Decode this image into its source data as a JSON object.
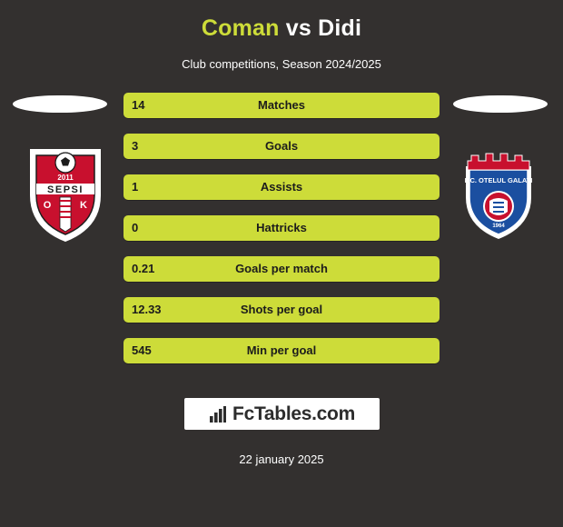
{
  "header": {
    "player_left": "Coman",
    "vs": "vs",
    "player_right": "Didi",
    "subtitle": "Club competitions, Season 2024/2025"
  },
  "colors": {
    "background": "#33302f",
    "bar": "#cddc39",
    "accent_title": "#cddc39",
    "text_light": "#ffffff",
    "text_dark": "#1c1c1c"
  },
  "teams": {
    "left": {
      "name": "Sepsi OSK",
      "crest_text_year": "2011",
      "crest_text_main": "SEPSI",
      "crest_letters": "OSK"
    },
    "right": {
      "name": "FC Otelul Galati",
      "crest_text_main": "F.C. OTELUL GALATI",
      "crest_text_small": "1964"
    }
  },
  "chart_data": {
    "type": "table",
    "title": "Coman vs Didi",
    "subtitle": "Club competitions, Season 2024/2025",
    "categories": [
      "Matches",
      "Goals",
      "Assists",
      "Hattricks",
      "Goals per match",
      "Shots per goal",
      "Min per goal"
    ],
    "series": [
      {
        "name": "Coman",
        "values": [
          "14",
          "3",
          "1",
          "0",
          "0.21",
          "12.33",
          "545"
        ]
      }
    ]
  },
  "rows": [
    {
      "value": "14",
      "label": "Matches"
    },
    {
      "value": "3",
      "label": "Goals"
    },
    {
      "value": "1",
      "label": "Assists"
    },
    {
      "value": "0",
      "label": "Hattricks"
    },
    {
      "value": "0.21",
      "label": "Goals per match"
    },
    {
      "value": "12.33",
      "label": "Shots per goal"
    },
    {
      "value": "545",
      "label": "Min per goal"
    }
  ],
  "footer": {
    "logo_text": "FcTables.com",
    "date": "22 january 2025"
  }
}
